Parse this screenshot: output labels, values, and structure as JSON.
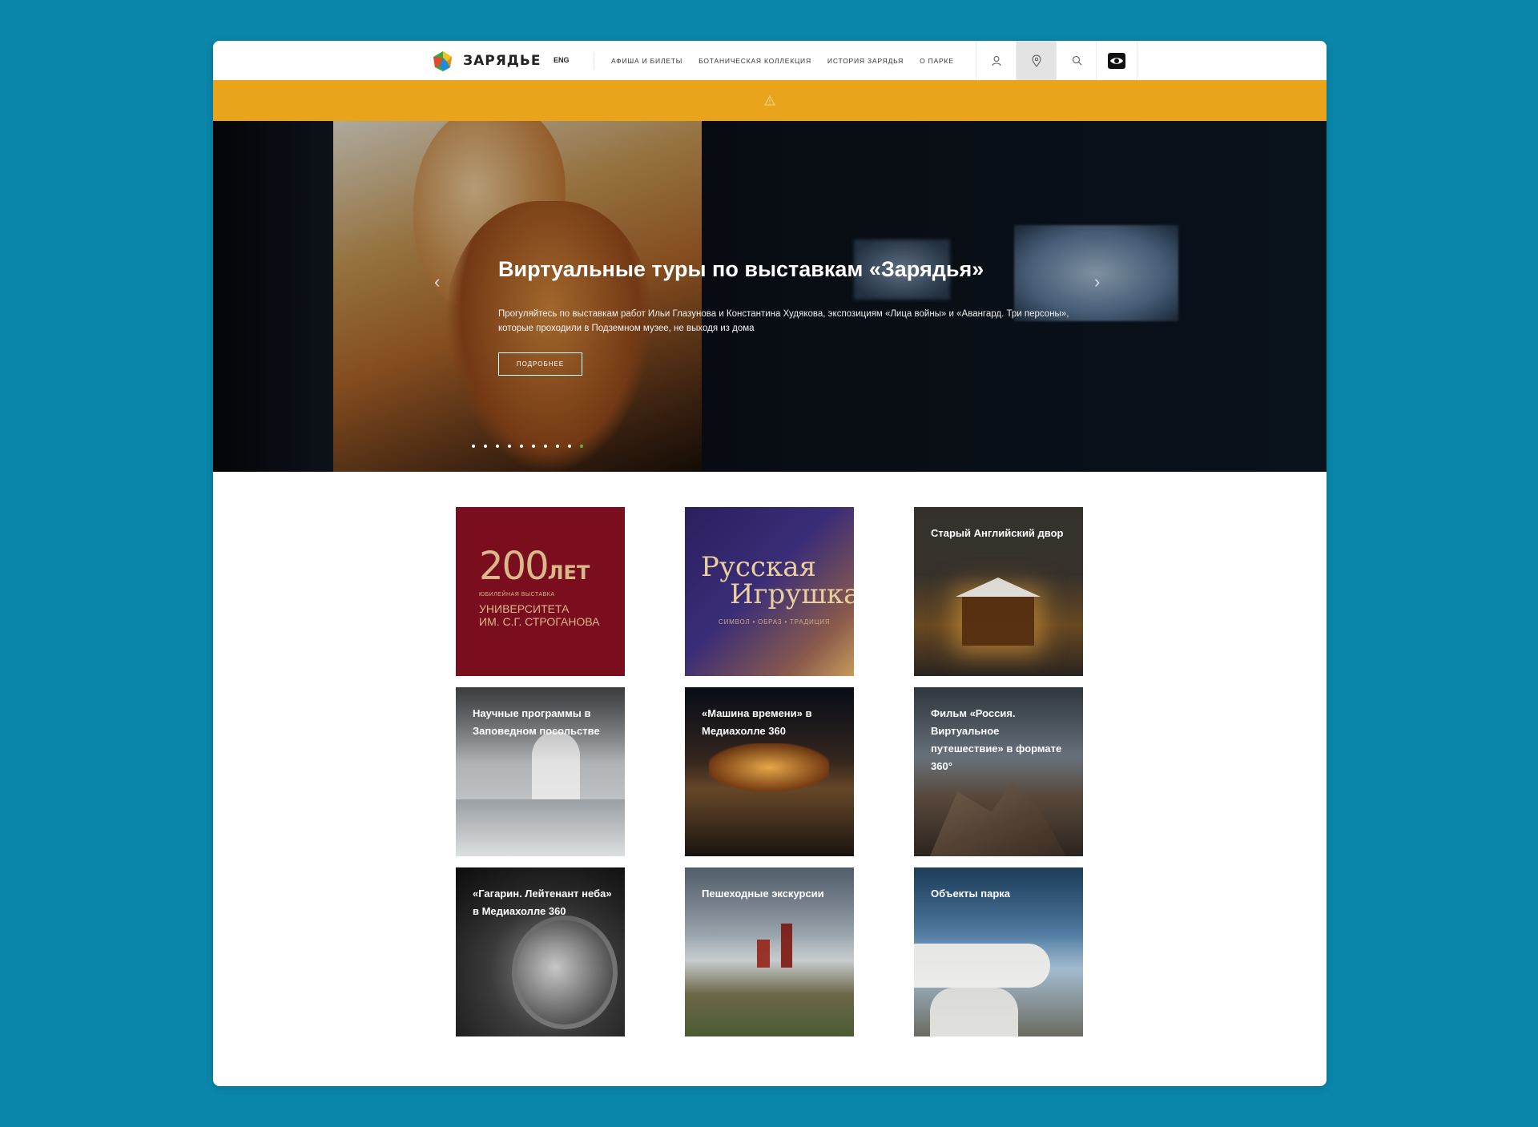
{
  "header": {
    "logo_text": "ЗАРЯДЬЕ",
    "lang": "ENG",
    "nav": [
      "АФИША И БИЛЕТЫ",
      "БОТАНИЧЕСКАЯ КОЛЛЕКЦИЯ",
      "ИСТОРИЯ ЗАРЯДЬЯ",
      "О ПАРКЕ"
    ],
    "icons": [
      "user-icon",
      "map-pin-icon",
      "search-icon",
      "accessibility-eye-icon"
    ]
  },
  "alert": {
    "icon": "warning-icon",
    "color": "#eaa41c"
  },
  "hero": {
    "title": "Виртуальные туры по выставкам «Зарядья»",
    "text": "Прогуляйтесь по выставкам работ Ильи Глазунова и Константина Худякова, экспозициям «Лица войны» и «Авангард. Три персоны», которые проходили в Подземном музее, не выходя из дома",
    "button": "подробнее",
    "slides_total": 10,
    "active_slide": 10,
    "active_dot_color": "#62b33a"
  },
  "tiles": [
    {
      "title": "",
      "art": {
        "big": "200",
        "big_suffix": "ЛЕТ",
        "small": "ЮБИЛЕЙНАЯ ВЫСТАВКА",
        "line1": "УНИВЕРСИТЕТА",
        "line2": "ИМ. С.Г. СТРОГАНОВА"
      }
    },
    {
      "title": "",
      "art": {
        "line1": "Русская",
        "line2": "Игрушка",
        "small": "СИМВОЛ • ОБРАЗ • ТРАДИЦИЯ"
      }
    },
    {
      "title": "Старый Английский двор"
    },
    {
      "title": "Научные программы в Заповедном посольстве"
    },
    {
      "title": "«Машина времени» в Медиахолле 360"
    },
    {
      "title": "Фильм «Россия. Виртуальное путешествие» в формате 360°"
    },
    {
      "title": "«Гагарин. Лейтенант неба» в Медиахолле 360"
    },
    {
      "title": "Пешеходные экскурсии"
    },
    {
      "title": "Объекты парка"
    }
  ]
}
